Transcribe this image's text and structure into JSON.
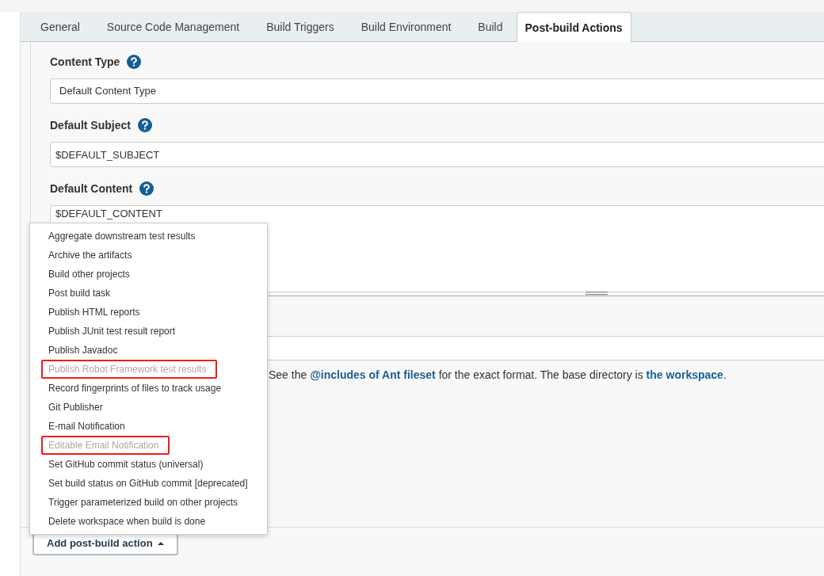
{
  "tabs": [
    {
      "label": "General",
      "selected": false
    },
    {
      "label": "Source Code Management",
      "selected": false
    },
    {
      "label": "Build Triggers",
      "selected": false
    },
    {
      "label": "Build Environment",
      "selected": false
    },
    {
      "label": "Build",
      "selected": false
    },
    {
      "label": "Post-build Actions",
      "selected": true
    }
  ],
  "fields": [
    {
      "label": "Content Type",
      "kind": "select",
      "value": "Default Content Type"
    },
    {
      "label": "Default Subject",
      "kind": "text",
      "value": "$DEFAULT_SUBJECT"
    },
    {
      "label": "Default Content",
      "kind": "textarea",
      "value": "$DEFAULT_CONTENT"
    }
  ],
  "help": [
    {
      "kind": "text",
      "text": "See the "
    },
    {
      "kind": "link",
      "text": "@includes of Ant fileset"
    },
    {
      "kind": "text",
      "text": " for the exact format. The base directory is "
    },
    {
      "kind": "link",
      "text": "the workspace"
    },
    {
      "kind": "text",
      "text": "."
    }
  ],
  "menu": [
    {
      "label": "Aggregate downstream test results",
      "disabled": false,
      "highlighted": false
    },
    {
      "label": "Archive the artifacts",
      "disabled": false,
      "highlighted": false
    },
    {
      "label": "Build other projects",
      "disabled": false,
      "highlighted": false
    },
    {
      "label": "Post build task",
      "disabled": false,
      "highlighted": false
    },
    {
      "label": "Publish HTML reports",
      "disabled": false,
      "highlighted": false
    },
    {
      "label": "Publish JUnit test result report",
      "disabled": false,
      "highlighted": false
    },
    {
      "label": "Publish Javadoc",
      "disabled": false,
      "highlighted": false
    },
    {
      "label": "Publish Robot Framework test results",
      "disabled": true,
      "highlighted": true
    },
    {
      "label": "Record fingerprints of files to track usage",
      "disabled": false,
      "highlighted": false
    },
    {
      "label": "Git Publisher",
      "disabled": false,
      "highlighted": false
    },
    {
      "label": "E-mail Notification",
      "disabled": false,
      "highlighted": false
    },
    {
      "label": "Editable Email Notification",
      "disabled": true,
      "highlighted": true
    },
    {
      "label": "Set GitHub commit status (universal)",
      "disabled": false,
      "highlighted": false
    },
    {
      "label": "Set build status on GitHub commit [deprecated]",
      "disabled": false,
      "highlighted": false
    },
    {
      "label": "Trigger parameterized build on other projects",
      "disabled": false,
      "highlighted": false
    },
    {
      "label": "Delete workspace when build is done",
      "disabled": false,
      "highlighted": false
    }
  ],
  "add_button": {
    "label": "Add post-build action",
    "expanded": true
  }
}
